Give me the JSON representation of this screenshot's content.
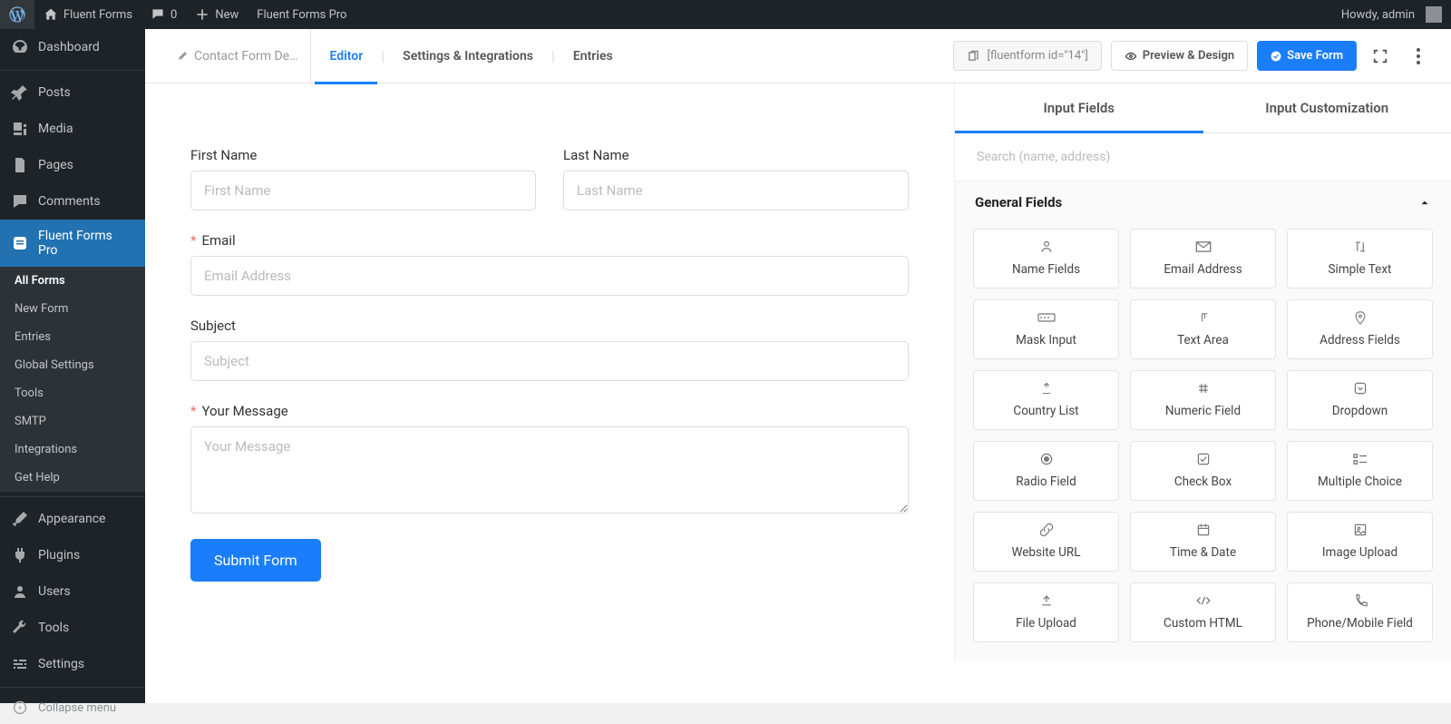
{
  "adminbar": {
    "site_name": "Fluent Forms",
    "comments": "0",
    "new": "New",
    "plugin": "Fluent Forms Pro",
    "howdy": "Howdy, admin"
  },
  "sidebar": {
    "items": [
      {
        "label": "Dashboard"
      },
      {
        "label": "Posts"
      },
      {
        "label": "Media"
      },
      {
        "label": "Pages"
      },
      {
        "label": "Comments"
      },
      {
        "label": "Fluent Forms Pro"
      }
    ],
    "submenu": [
      {
        "label": "All Forms"
      },
      {
        "label": "New Form"
      },
      {
        "label": "Entries"
      },
      {
        "label": "Global Settings"
      },
      {
        "label": "Tools"
      },
      {
        "label": "SMTP"
      },
      {
        "label": "Integrations"
      },
      {
        "label": "Get Help"
      }
    ],
    "items2": [
      {
        "label": "Appearance"
      },
      {
        "label": "Plugins"
      },
      {
        "label": "Users"
      },
      {
        "label": "Tools"
      },
      {
        "label": "Settings"
      }
    ],
    "collapse": "Collapse menu"
  },
  "top": {
    "form_name": "Contact Form De…",
    "tabs": {
      "editor": "Editor",
      "settings": "Settings & Integrations",
      "entries": "Entries"
    },
    "shortcode": "[fluentform id=\"14\"]",
    "preview": "Preview & Design",
    "save": "Save Form"
  },
  "form": {
    "first_name": {
      "label": "First Name",
      "placeholder": "First Name"
    },
    "last_name": {
      "label": "Last Name",
      "placeholder": "Last Name"
    },
    "email": {
      "label": "Email",
      "placeholder": "Email Address"
    },
    "subject": {
      "label": "Subject",
      "placeholder": "Subject"
    },
    "message": {
      "label": "Your Message",
      "placeholder": "Your Message"
    },
    "submit": "Submit Form"
  },
  "panel": {
    "tabs": {
      "input": "Input Fields",
      "custom": "Input Customization"
    },
    "search_placeholder": "Search (name, address)",
    "section": "General Fields",
    "fields": [
      {
        "label": "Name Fields"
      },
      {
        "label": "Email Address"
      },
      {
        "label": "Simple Text"
      },
      {
        "label": "Mask Input"
      },
      {
        "label": "Text Area"
      },
      {
        "label": "Address Fields"
      },
      {
        "label": "Country List"
      },
      {
        "label": "Numeric Field"
      },
      {
        "label": "Dropdown"
      },
      {
        "label": "Radio Field"
      },
      {
        "label": "Check Box"
      },
      {
        "label": "Multiple Choice"
      },
      {
        "label": "Website URL"
      },
      {
        "label": "Time & Date"
      },
      {
        "label": "Image Upload"
      },
      {
        "label": "File Upload"
      },
      {
        "label": "Custom HTML"
      },
      {
        "label": "Phone/Mobile Field"
      }
    ]
  }
}
